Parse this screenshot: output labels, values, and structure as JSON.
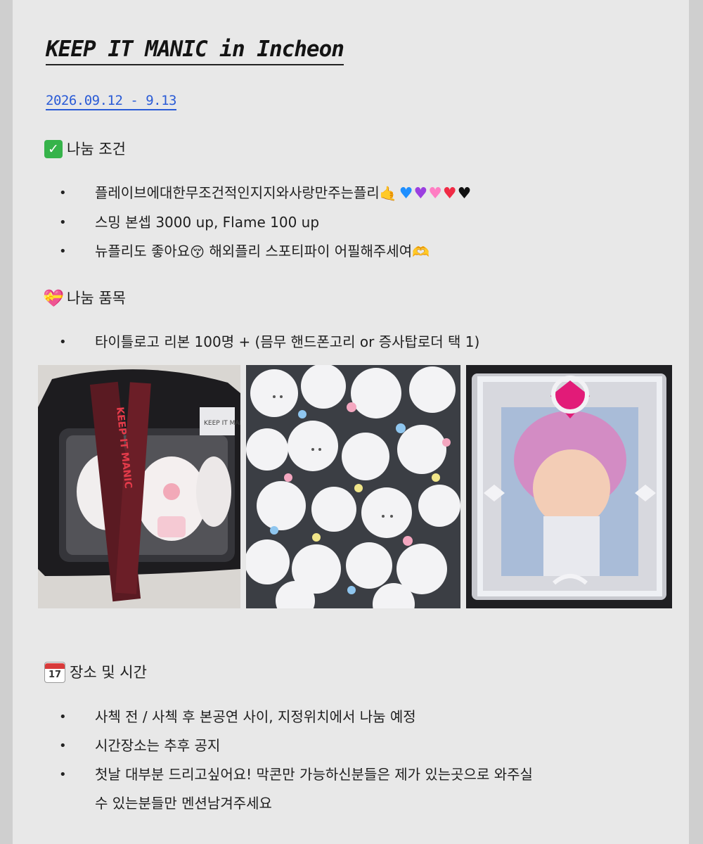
{
  "title": "KEEP IT MANIC in Incheon",
  "date": "2026.09.12 - 9.13",
  "conditions": {
    "heading": "나눔 조건",
    "icon": "check-mark-button-icon",
    "items": [
      "플레이브에대한무조건적인지지와사랑만주는플리",
      "스밍 본셉 3000 up, Flame 100 up",
      "뉴플리도 좋아요",
      "해외플리 스포티파이 어필해주세여"
    ]
  },
  "items_section": {
    "heading": "나눔 품목",
    "icon": "gift-heart-icon",
    "items": [
      "타이틀로고 리본 100명 + (믐무 핸드폰고리 or 증사탑로더 택 1)"
    ]
  },
  "photos": {
    "bag_ribbon_text": "KEEP IT MANIC",
    "bag_tag_text": "KEEP IT MANIC"
  },
  "place_time": {
    "heading": "장소 및 시간",
    "icon": "calendar-icon",
    "calendar_day": "17",
    "items": [
      "사첵 전 / 사첵 후 본공연 사이, 지정위치에서 나눔 예정",
      "시간장소는 추후 공지"
    ],
    "long_item_line1": "첫날 대부분 드리고싶어요! 막콘만 가능하신분들은 제가 있는곳으로 와주실",
    "long_item_line2": "수 있는분들만 멘션남겨주세요"
  },
  "colors": {
    "link": "#2a5bd6",
    "page_bg": "#e8e8e8",
    "outer_bg": "#cfcfcf"
  }
}
